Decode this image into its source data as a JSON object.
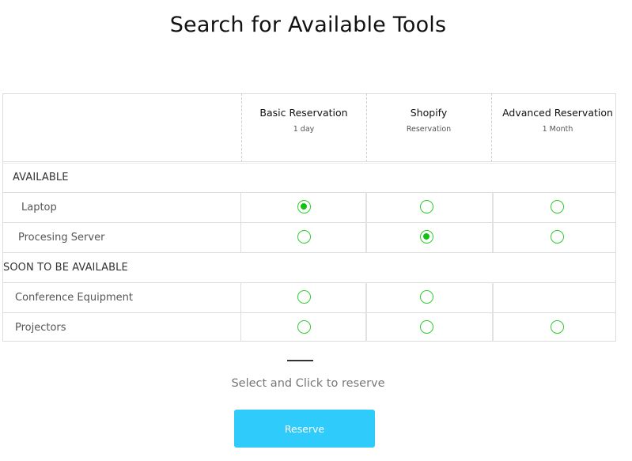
{
  "title": "Search for Available Tools",
  "plans": [
    {
      "name": "Basic Reservation",
      "sub": "1 day"
    },
    {
      "name": "Shopify",
      "sub": "Reservation"
    },
    {
      "name": "Advanced Reservation",
      "sub": "1 Month"
    }
  ],
  "sections": [
    {
      "label": "AVAILABLE",
      "rows": [
        {
          "label": "Laptop",
          "options": [
            "checked",
            "unchecked",
            "unchecked"
          ]
        },
        {
          "label": "Procesing Server",
          "options": [
            "unchecked",
            "checked",
            "unchecked"
          ]
        }
      ]
    },
    {
      "label": "SOON TO BE AVAILABLE",
      "rows": [
        {
          "label": "Conference Equipment",
          "options": [
            "unchecked",
            "unchecked",
            "none"
          ]
        },
        {
          "label": "Projectors",
          "options": [
            "unchecked",
            "unchecked",
            "unchecked"
          ]
        }
      ]
    }
  ],
  "hint": "Select and Click to reserve",
  "reserve_label": "Reserve",
  "colors": {
    "accent": "#2ecbfb",
    "radio": "#2ecc2e",
    "radio_fill": "#12c212"
  }
}
